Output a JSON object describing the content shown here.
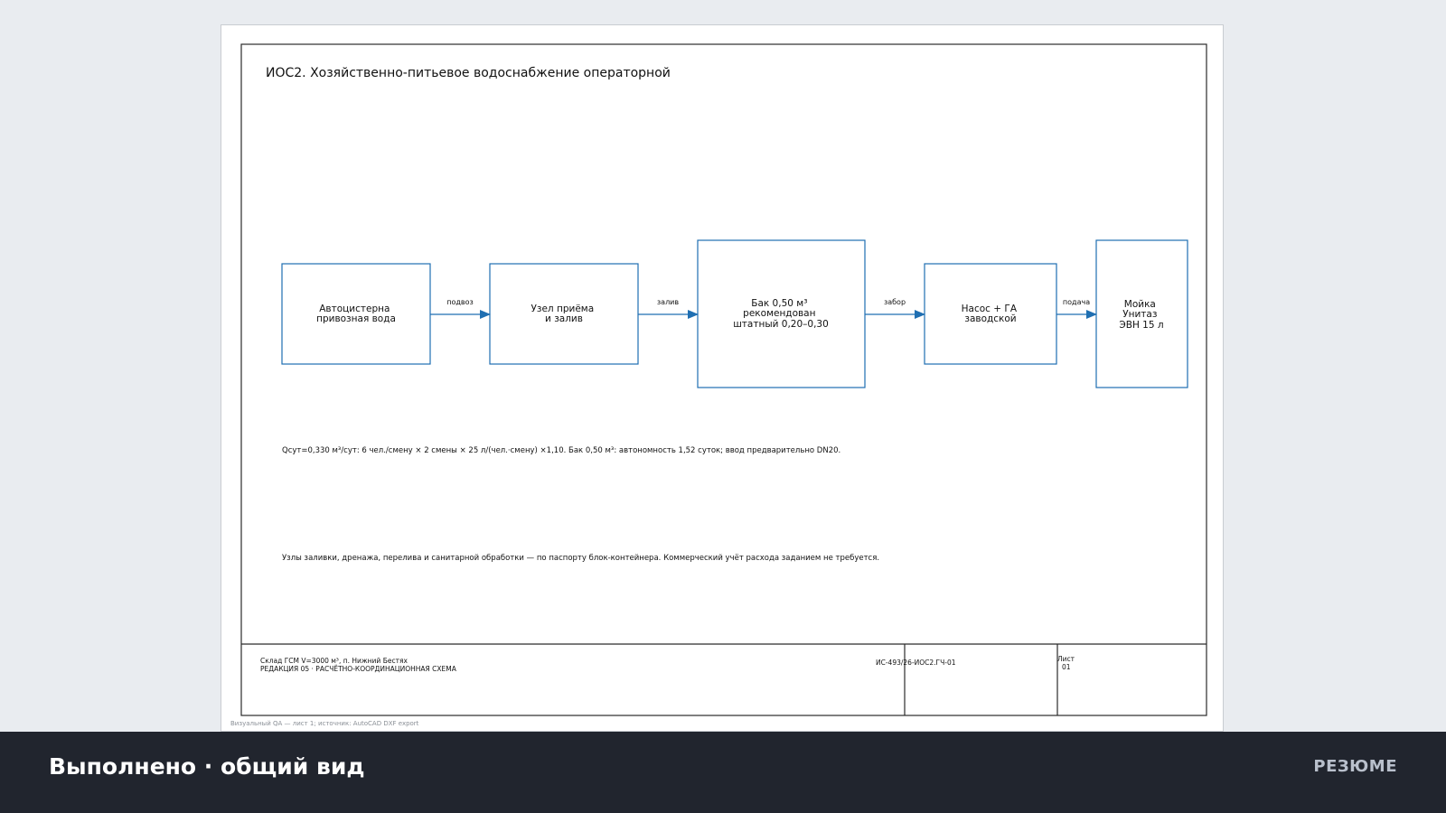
{
  "drawing": {
    "title": "ИОС2. Хозяйственно-питьевое водоснабжение операторной",
    "nodes": [
      {
        "id": "truck",
        "lines": [
          "Автоцистерна",
          "привозная вода"
        ]
      },
      {
        "id": "intake",
        "lines": [
          "Узел приёма",
          "и залив"
        ]
      },
      {
        "id": "tank",
        "lines": [
          "Бак 0,50 м³",
          "рекомендован",
          "штатный 0,20–0,30"
        ]
      },
      {
        "id": "pump",
        "lines": [
          "Насос + ГА",
          "заводской"
        ]
      },
      {
        "id": "consumers",
        "lines": [
          "Мойка",
          "Унитаз",
          "ЭВН 15 л"
        ]
      }
    ],
    "links": [
      {
        "label": "подвоз"
      },
      {
        "label": "залив"
      },
      {
        "label": "забор"
      },
      {
        "label": "подача"
      }
    ],
    "note_calc": "Qсут=0,330 м³/сут: 6 чел./смену × 2 смены × 25 л/(чел.·смену) ×1,10. Бак 0,50 м³: автономность 1,52 суток; ввод предварительно DN20.",
    "note_scope": "Узлы заливки, дренажа, перелива и санитарной обработки — по паспорту блок-контейнера. Коммерческий учёт расхода заданием не требуется.",
    "stamp": {
      "project_line1": "Склад ГСМ V=3000 м³, п. Нижний Бестях",
      "project_line2": "РЕДАКЦИЯ 05 · РАСЧЁТНО-КООРДИНАЦИОННАЯ СХЕМА",
      "code": "ИС-493/26-ИОС2.ГЧ-01",
      "sheet_label": "Лист",
      "sheet_number": "01"
    },
    "source_note": "Визуальный QA — лист 1; источник: AutoCAD DXF export",
    "colors": {
      "box_stroke": "#1f6fb2",
      "arrow": "#1f6fb2",
      "frame": "#2b2b2b"
    }
  },
  "footer": {
    "title": "Выполнено · общий вид",
    "action_label": "РЕЗЮМЕ"
  }
}
